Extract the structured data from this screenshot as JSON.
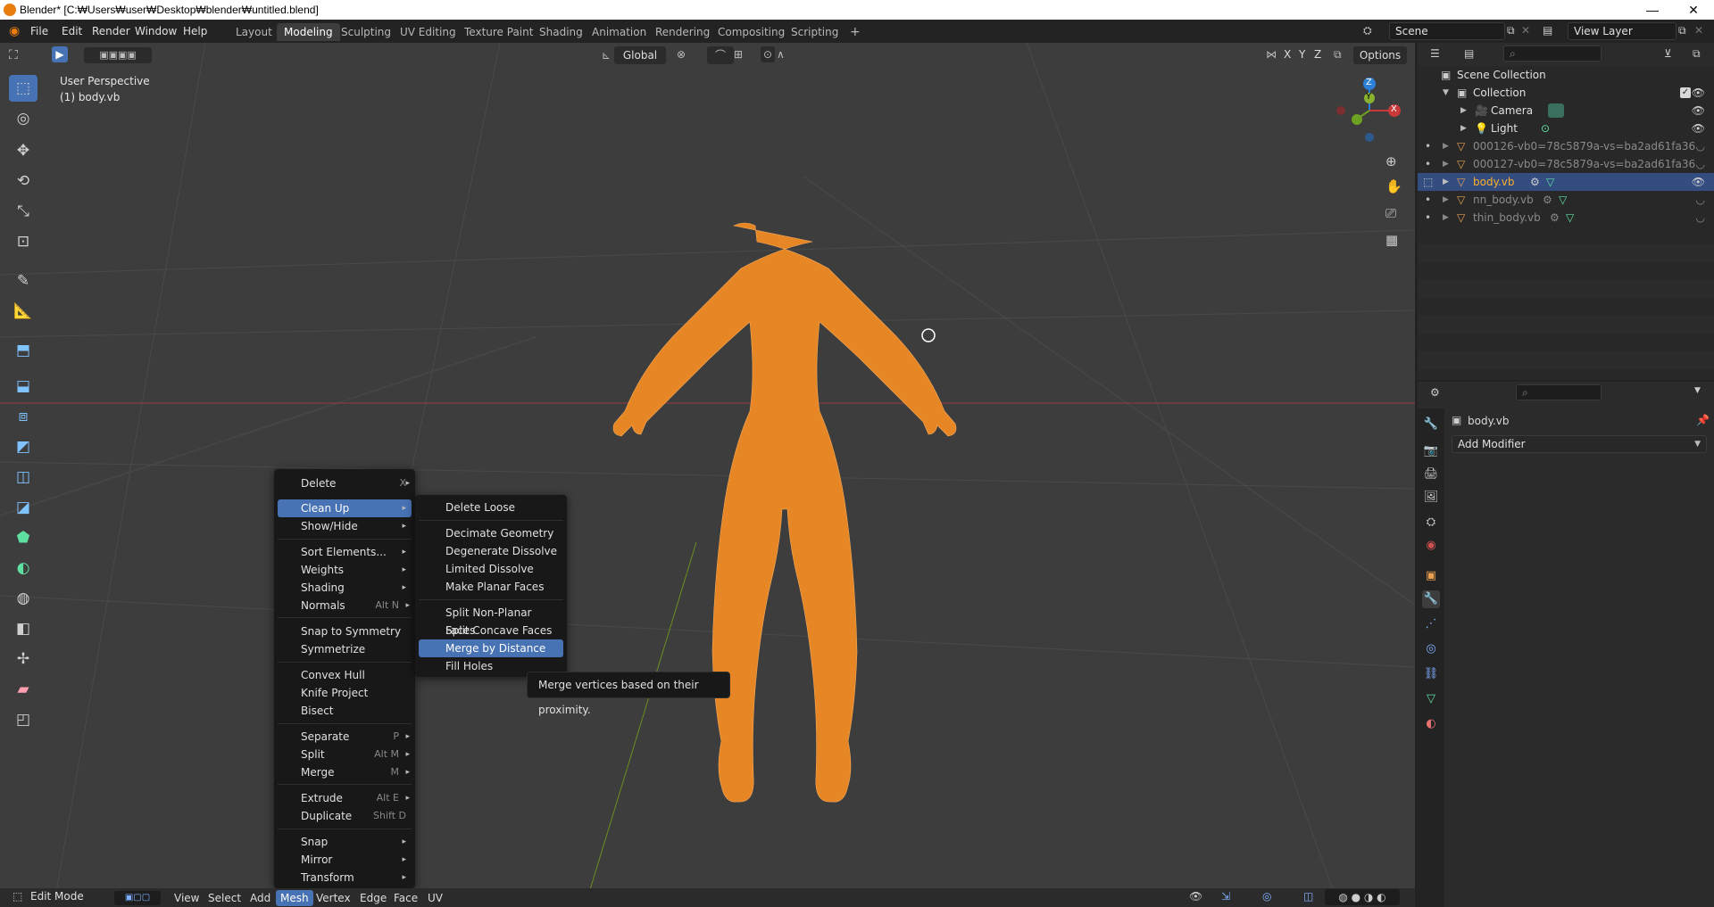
{
  "window": {
    "title": "Blender* [C:₩Users₩user₩Desktop₩blender₩untitled.blend]",
    "minimize": "—",
    "maximize": "❐",
    "close": "✕"
  },
  "menubar": {
    "items": [
      "File",
      "Edit",
      "Render",
      "Window",
      "Help"
    ]
  },
  "workspaces": {
    "tabs": [
      "Layout",
      "Modeling",
      "Sculpting",
      "UV Editing",
      "Texture Paint",
      "Shading",
      "Animation",
      "Rendering",
      "Compositing",
      "Scripting"
    ],
    "active": "Modeling",
    "add": "+"
  },
  "scene": {
    "scene_name": "Scene",
    "view_layer": "View Layer"
  },
  "viewport_header": {
    "transform_orientation": "Global",
    "options": "Options",
    "axes": [
      "X",
      "Y",
      "Z"
    ]
  },
  "viewport": {
    "view_name": "User Perspective",
    "object_label": "(1) body.vb",
    "gizmo": {
      "z": "Z",
      "y": "Y",
      "x": "X"
    }
  },
  "mesh_menu": {
    "items": [
      {
        "label": "Delete",
        "shortcut": "X",
        "submenu": true
      },
      {
        "label": "Clean Up",
        "shortcut": "",
        "submenu": true
      },
      {
        "label": "Show/Hide",
        "shortcut": "",
        "submenu": true
      },
      {
        "label": "Sort Elements...",
        "shortcut": "",
        "submenu": true
      },
      {
        "label": "Weights",
        "shortcut": "",
        "submenu": true
      },
      {
        "label": "Shading",
        "shortcut": "",
        "submenu": true
      },
      {
        "label": "Normals",
        "shortcut": "Alt N",
        "submenu": true
      },
      {
        "label": "Snap to Symmetry",
        "shortcut": "",
        "submenu": false
      },
      {
        "label": "Symmetrize",
        "shortcut": "",
        "submenu": false
      },
      {
        "label": "Convex Hull",
        "shortcut": "",
        "submenu": false
      },
      {
        "label": "Knife Project",
        "shortcut": "",
        "submenu": false
      },
      {
        "label": "Bisect",
        "shortcut": "",
        "submenu": false
      },
      {
        "label": "Separate",
        "shortcut": "P",
        "submenu": true
      },
      {
        "label": "Split",
        "shortcut": "Alt M",
        "submenu": true
      },
      {
        "label": "Merge",
        "shortcut": "M",
        "submenu": true
      },
      {
        "label": "Extrude",
        "shortcut": "Alt E",
        "submenu": true
      },
      {
        "label": "Duplicate",
        "shortcut": "Shift D",
        "submenu": false
      },
      {
        "label": "Snap",
        "shortcut": "",
        "submenu": true
      },
      {
        "label": "Mirror",
        "shortcut": "",
        "submenu": true
      },
      {
        "label": "Transform",
        "shortcut": "",
        "submenu": true
      }
    ]
  },
  "cleanup_menu": {
    "items": [
      "Delete Loose",
      "Decimate Geometry",
      "Degenerate Dissolve",
      "Limited Dissolve",
      "Make Planar Faces",
      "Split Non-Planar Faces",
      "Split Concave Faces",
      "Merge by Distance",
      "Fill Holes"
    ]
  },
  "tooltip": "Merge vertices based on their proximity.",
  "bottom_bar": {
    "mode": "Edit Mode",
    "menus": [
      "View",
      "Select",
      "Add",
      "Mesh",
      "Vertex",
      "Edge",
      "Face",
      "UV"
    ],
    "active_menu": "Mesh"
  },
  "outliner": {
    "rows": [
      {
        "label": "Scene Collection"
      },
      {
        "label": "Collection"
      },
      {
        "label": "Camera"
      },
      {
        "label": "Light"
      },
      {
        "label": "000126-vb0=78c5879a-vs=ba2ad61fa36"
      },
      {
        "label": "000127-vb0=78c5879a-vs=ba2ad61fa36"
      },
      {
        "label": "body.vb"
      },
      {
        "label": "nn_body.vb"
      },
      {
        "label": "thin_body.vb"
      }
    ]
  },
  "properties": {
    "object_name": "body.vb",
    "add_modifier": "Add Modifier"
  },
  "colors": {
    "accent": "#4772b3",
    "mesh_orange": "#f08a24",
    "selected_row": "#334d80"
  }
}
